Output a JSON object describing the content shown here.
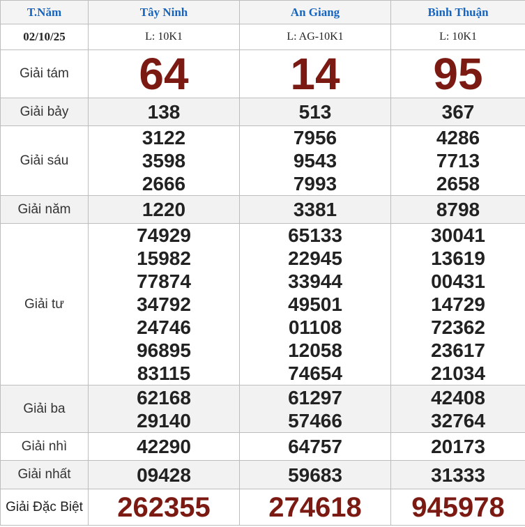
{
  "header": {
    "day": "T.Năm",
    "provinces": [
      "Tây Ninh",
      "An Giang",
      "Bình Thuận"
    ]
  },
  "subheader": {
    "date": "02/10/25",
    "codes": [
      "L: 10K1",
      "L: AG-10K1",
      "L: 10K1"
    ]
  },
  "prizes": {
    "g8": {
      "label": "Giải tám",
      "values": [
        "64",
        "14",
        "95"
      ]
    },
    "g7": {
      "label": "Giải bảy",
      "values": [
        "138",
        "513",
        "367"
      ]
    },
    "g6": {
      "label": "Giải sáu",
      "values": [
        [
          "3122",
          "3598",
          "2666"
        ],
        [
          "7956",
          "9543",
          "7993"
        ],
        [
          "4286",
          "7713",
          "2658"
        ]
      ]
    },
    "g5": {
      "label": "Giải năm",
      "values": [
        "1220",
        "3381",
        "8798"
      ]
    },
    "g4": {
      "label": "Giải tư",
      "values": [
        [
          "74929",
          "15982",
          "77874",
          "34792",
          "24746",
          "96895",
          "83115"
        ],
        [
          "65133",
          "22945",
          "33944",
          "49501",
          "01108",
          "12058",
          "74654"
        ],
        [
          "30041",
          "13619",
          "00431",
          "14729",
          "72362",
          "23617",
          "21034"
        ]
      ]
    },
    "g3": {
      "label": "Giải ba",
      "values": [
        [
          "62168",
          "29140"
        ],
        [
          "61297",
          "57466"
        ],
        [
          "42408",
          "32764"
        ]
      ]
    },
    "g2": {
      "label": "Giải nhì",
      "values": [
        "42290",
        "64757",
        "20173"
      ]
    },
    "g1": {
      "label": "Giải nhất",
      "values": [
        "09428",
        "59683",
        "31333"
      ]
    },
    "db": {
      "label": "Giải Đặc Biệt",
      "values": [
        "262355",
        "274618",
        "945978"
      ]
    }
  },
  "colors": {
    "header_text": "#1565c0",
    "highlight_number": "#7b1a12",
    "row_gray": "#f2f2f2",
    "border": "#bdbdbd"
  }
}
